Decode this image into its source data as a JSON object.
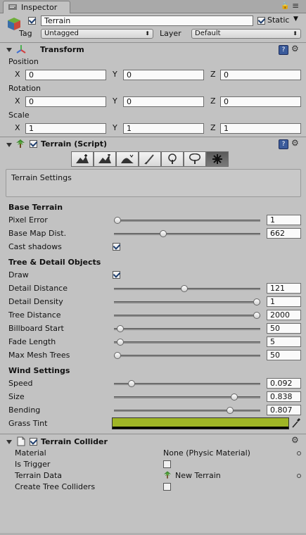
{
  "window": {
    "tab_title": "Inspector",
    "lock_glyph": "🔒",
    "menu_glyph": "≡"
  },
  "object": {
    "name": "Terrain",
    "static_label": "Static",
    "tag_label": "Tag",
    "tag_value": "Untagged",
    "layer_label": "Layer",
    "layer_value": "Default"
  },
  "transform": {
    "title": "Transform",
    "position_label": "Position",
    "rotation_label": "Rotation",
    "scale_label": "Scale",
    "x_label": "X",
    "y_label": "Y",
    "z_label": "Z",
    "position": {
      "x": "0",
      "y": "0",
      "z": "0"
    },
    "rotation": {
      "x": "0",
      "y": "0",
      "z": "0"
    },
    "scale": {
      "x": "1",
      "y": "1",
      "z": "1"
    }
  },
  "terrain_script": {
    "title": "Terrain (Script)",
    "tools": [
      "raise-lower-terrain-icon",
      "paint-height-icon",
      "smooth-height-icon",
      "paint-texture-icon",
      "place-trees-icon",
      "paint-details-icon",
      "terrain-settings-icon"
    ],
    "info_text": "Terrain Settings",
    "base_terrain": {
      "heading": "Base Terrain",
      "pixel_error_label": "Pixel Error",
      "pixel_error": "1",
      "pixel_error_level": 0.0,
      "base_map_label": "Base Map Dist.",
      "base_map": "662",
      "base_map_level": 0.33,
      "cast_shadows_label": "Cast shadows",
      "cast_shadows": true
    },
    "tree_detail": {
      "heading": "Tree & Detail Objects",
      "draw_label": "Draw",
      "draw": true,
      "detail_distance_label": "Detail Distance",
      "detail_distance": "121",
      "detail_distance_level": 0.48,
      "detail_density_label": "Detail Density",
      "detail_density": "1",
      "detail_density_level": 1.0,
      "tree_distance_label": "Tree Distance",
      "tree_distance": "2000",
      "tree_distance_level": 1.0,
      "billboard_start_label": "Billboard Start",
      "billboard_start": "50",
      "billboard_start_level": 0.02,
      "fade_length_label": "Fade Length",
      "fade_length": "5",
      "fade_length_level": 0.02,
      "max_mesh_trees_label": "Max Mesh Trees",
      "max_mesh_trees": "50",
      "max_mesh_trees_level": 0.0
    },
    "wind": {
      "heading": "Wind Settings",
      "speed_label": "Speed",
      "speed": "0.092",
      "speed_level": 0.1,
      "size_label": "Size",
      "size": "0.838",
      "size_level": 0.84,
      "bending_label": "Bending",
      "bending": "0.807",
      "bending_level": 0.81,
      "grass_tint_label": "Grass Tint",
      "grass_tint_color": "#9fb526"
    }
  },
  "terrain_collider": {
    "title": "Terrain Collider",
    "material_label": "Material",
    "material_value": "None (Physic Material)",
    "is_trigger_label": "Is Trigger",
    "is_trigger": false,
    "terrain_data_label": "Terrain Data",
    "terrain_data_value": "New Terrain",
    "create_tree_colliders_label": "Create Tree Colliders",
    "create_tree_colliders": false
  }
}
